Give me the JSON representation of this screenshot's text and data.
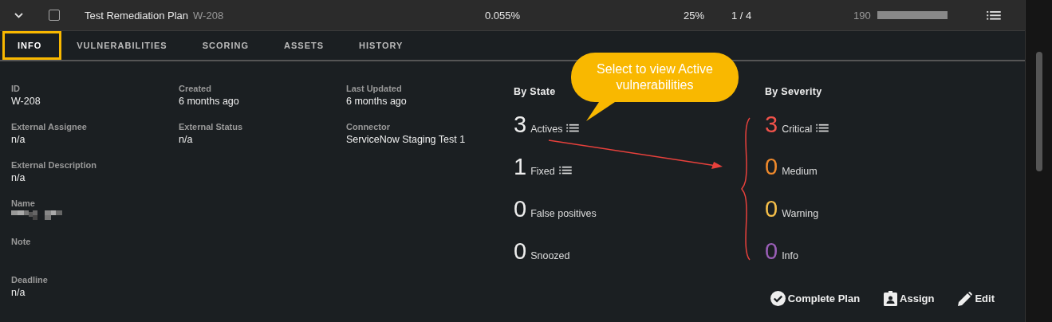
{
  "plan_row": {
    "expanded": true,
    "checked": false,
    "title": "Test Remediation Plan",
    "id": "W-208",
    "percent": "0.055%",
    "progress": "25%",
    "fraction": "1 / 4",
    "count": "190",
    "level": 1
  },
  "tabs": [
    {
      "label": "INFO",
      "selected": true
    },
    {
      "label": "VULNERABILITIES",
      "selected": false
    },
    {
      "label": "SCORING",
      "selected": false
    },
    {
      "label": "ASSETS",
      "selected": false
    },
    {
      "label": "HISTORY",
      "selected": false
    }
  ],
  "info_columns": [
    [
      {
        "label": "ID",
        "value": "W-208",
        "kind": "text"
      },
      {
        "label": "External Assignee",
        "value": "n/a",
        "kind": "text"
      },
      {
        "label": "External Description",
        "value": "n/a",
        "kind": "text"
      },
      {
        "label": "Name",
        "kind": "redacted"
      },
      {
        "label": "Note",
        "kind": "empty"
      },
      {
        "label": "Deadline",
        "value": "n/a",
        "kind": "text"
      }
    ],
    [
      {
        "label": "Created",
        "value": "6 months ago",
        "kind": "text"
      },
      {
        "label": "External Status",
        "value": "n/a",
        "kind": "text"
      }
    ],
    [
      {
        "label": "Last Updated",
        "value": "6 months ago",
        "kind": "text"
      },
      {
        "label": "Connector",
        "value": "ServiceNow Staging Test 1",
        "kind": "text"
      }
    ]
  ],
  "by_state": {
    "title": "By State",
    "items": [
      {
        "count": "3",
        "label": "Actives",
        "list_link": true
      },
      {
        "count": "1",
        "label": "Fixed",
        "list_link": true
      },
      {
        "count": "0",
        "label": "False positives",
        "list_link": false
      },
      {
        "count": "0",
        "label": "Snoozed",
        "list_link": false
      }
    ]
  },
  "by_severity": {
    "title": "By Severity",
    "items": [
      {
        "count": "3",
        "label": "Critical",
        "list_link": true,
        "color": "#f0524a"
      },
      {
        "count": "0",
        "label": "Medium",
        "list_link": false,
        "color": "#f08a2c"
      },
      {
        "count": "0",
        "label": "Warning",
        "list_link": false,
        "color": "#f7c04a"
      },
      {
        "count": "0",
        "label": "Info",
        "list_link": false,
        "color": "#9b5fb8"
      }
    ]
  },
  "actions": [
    {
      "label": "Complete Plan",
      "kind": "complete"
    },
    {
      "label": "Assign",
      "kind": "assign"
    },
    {
      "label": "Edit",
      "kind": "edit"
    }
  ],
  "annotations": [
    {
      "kind": "highlight"
    },
    {
      "kind": "callout",
      "text": "Select to view Active vulnerabilities"
    },
    {
      "kind": "arrow"
    },
    {
      "kind": "brace"
    }
  ]
}
